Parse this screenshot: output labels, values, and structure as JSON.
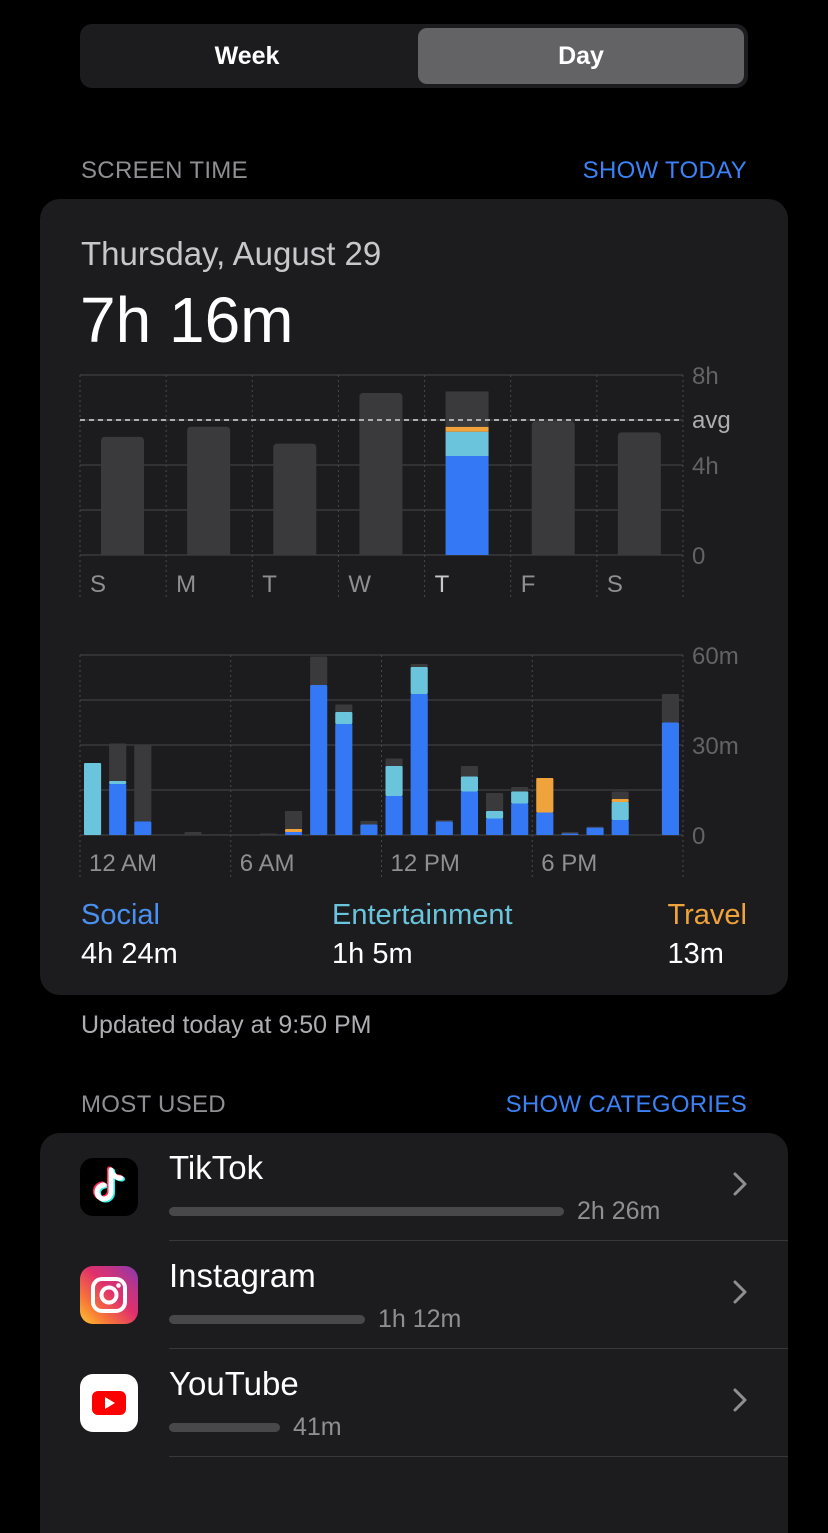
{
  "segment": {
    "week_label": "Week",
    "day_label": "Day",
    "selected": "Day"
  },
  "screen_time": {
    "header": "SCREEN TIME",
    "show_today": "SHOW TODAY",
    "date": "Thursday, August 29",
    "total": "7h 16m",
    "updated": "Updated today at 9:50 PM"
  },
  "colors": {
    "social": "#3478f6",
    "entertainment": "#6ac4dc",
    "travel": "#f0a33a",
    "other": "#3a3a3c",
    "accent": "#3b82f6"
  },
  "chart_data": [
    {
      "type": "bar",
      "categories": [
        "S",
        "M",
        "T",
        "W",
        "T",
        "F",
        "S"
      ],
      "highlight_index": 4,
      "total_hours": [
        5.25,
        5.7,
        4.95,
        7.2,
        7.27,
        5.95,
        5.45
      ],
      "highlight_segments": [
        {
          "name": "Social",
          "value": 4.4
        },
        {
          "name": "Entertainment",
          "value": 1.08
        },
        {
          "name": "Travel",
          "value": 0.22
        },
        {
          "name": "Other",
          "value": 1.57
        }
      ],
      "ylim": [
        0,
        8
      ],
      "yticks": [
        "0",
        "4h",
        "8h"
      ],
      "avg_label": "avg",
      "avg_value": 6.0
    },
    {
      "type": "bar",
      "hours": [
        0,
        1,
        2,
        3,
        4,
        5,
        6,
        7,
        8,
        9,
        10,
        11,
        12,
        13,
        14,
        15,
        16,
        17,
        18,
        19,
        20,
        21,
        22,
        23
      ],
      "xtick_labels": [
        "12 AM",
        "6 AM",
        "12 PM",
        "6 PM"
      ],
      "yticks": [
        "0",
        "30m",
        "60m"
      ],
      "ylim": [
        0,
        60
      ],
      "series": [
        {
          "name": "Social",
          "values": [
            0,
            17,
            4.5,
            0,
            0,
            0,
            0,
            0,
            1,
            50,
            37,
            3.5,
            13,
            47,
            4.5,
            14.5,
            5.5,
            10.5,
            7.5,
            0.5,
            2.5,
            5,
            0,
            37.5
          ]
        },
        {
          "name": "Entertainment",
          "values": [
            24,
            1,
            0,
            0,
            0,
            0,
            0,
            0,
            0,
            0,
            4,
            0,
            10,
            9,
            0,
            5,
            2.5,
            4,
            0,
            0,
            0,
            6,
            0,
            0
          ]
        },
        {
          "name": "Travel",
          "values": [
            0,
            0,
            0,
            0,
            0,
            0,
            0,
            0,
            1,
            0,
            0,
            0,
            0,
            0,
            0,
            0,
            0,
            0,
            11.5,
            0,
            0,
            1,
            0,
            0
          ]
        },
        {
          "name": "Other",
          "values": [
            0,
            12.5,
            25.5,
            0,
            1,
            0.3,
            0,
            0.5,
            6,
            9.5,
            2.5,
            1.2,
            2.5,
            1,
            0.5,
            3.5,
            6,
            1.5,
            0,
            0.5,
            0.3,
            2.5,
            0,
            9.5
          ]
        }
      ]
    }
  ],
  "legend": [
    {
      "label": "Social",
      "value": "4h 24m",
      "color": "#4a90f0"
    },
    {
      "label": "Entertainment",
      "value": "1h 5m",
      "color": "#6ac4dc"
    },
    {
      "label": "Travel",
      "value": "13m",
      "color": "#f0a33a"
    }
  ],
  "most_used": {
    "header": "MOST USED",
    "show_categories": "SHOW CATEGORIES",
    "apps": [
      {
        "name": "TikTok",
        "time": "2h 26m",
        "usage_fraction": 1.0,
        "icon": "tiktok-icon"
      },
      {
        "name": "Instagram",
        "time": "1h 12m",
        "usage_fraction": 0.49,
        "icon": "instagram-icon"
      },
      {
        "name": "YouTube",
        "time": "41m",
        "usage_fraction": 0.28,
        "icon": "youtube-icon"
      }
    ]
  }
}
